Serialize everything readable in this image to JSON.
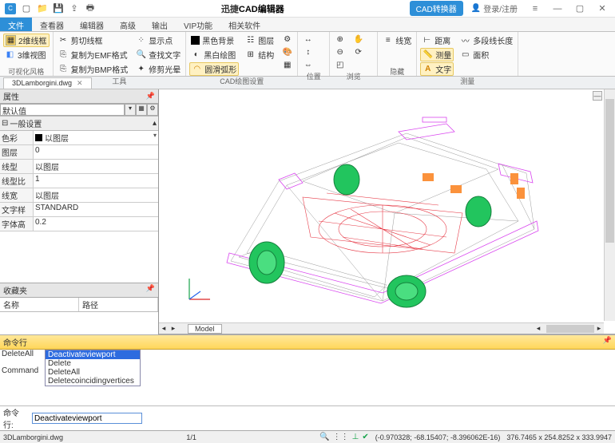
{
  "titlebar": {
    "app_title_prefix": "迅捷",
    "app_title_suffix": "CAD编辑器",
    "cad_converter": "CAD转换器",
    "login": "登录/注册"
  },
  "menubar": {
    "tabs": [
      "文件",
      "查看器",
      "编辑器",
      "高级",
      "输出",
      "VIP功能",
      "相关软件"
    ]
  },
  "ribbon": {
    "g1": {
      "btn1": "2维线框",
      "btn2": "3维视图",
      "label": "可视化风格"
    },
    "g2": {
      "a": "剪切线框",
      "b": "复制为EMF格式",
      "c": "复制为BMP格式",
      "d": "显示点",
      "e": "查找文字",
      "f": "修剪光晕",
      "label": "工具"
    },
    "g3": {
      "a": "黑色背景",
      "b": "黑白绘图",
      "c": "圆滑弧形",
      "d": "图层",
      "e": "结构",
      "label": "CAD绘图设置"
    },
    "g4": {
      "label": "位置"
    },
    "g5": {
      "label": "浏览"
    },
    "g6": {
      "a": "线宽",
      "label": "隐藏"
    },
    "g7": {
      "a": "距离",
      "b": "测量",
      "c": "文字",
      "d": "多段线长度",
      "e": "面积",
      "label": "测量"
    }
  },
  "file_tab": {
    "name": "3DLamborgini.dwg"
  },
  "props": {
    "panel_title": "属性",
    "default_value": "默认值",
    "section": "一般设置",
    "rows": {
      "color": {
        "k": "色彩",
        "v": "以图层"
      },
      "layer": {
        "k": "图层",
        "v": "0"
      },
      "ltype": {
        "k": "线型",
        "v": "以图层"
      },
      "lscale": {
        "k": "线型比",
        "v": "1"
      },
      "lweight": {
        "k": "线宽",
        "v": "以图层"
      },
      "tstyle": {
        "k": "文字样",
        "v": "STANDARD"
      },
      "theight": {
        "k": "字体高",
        "v": "0.2"
      }
    }
  },
  "fav": {
    "title": "收藏夹",
    "col1": "名称",
    "col2": "路径"
  },
  "viewport": {
    "model_tab": "Model"
  },
  "cmd": {
    "header": "命令行",
    "rows": {
      "r1": {
        "k": "DeleteAll",
        "v": "Deactivateviewport"
      },
      "r2": {
        "k": "Command",
        "v": ""
      }
    },
    "dropdown": [
      "Deactivateviewport",
      "Delete",
      "DeleteAll",
      "Deletecoincidingvertices"
    ],
    "input_label": "命令行:",
    "input_value": "Deactivateviewport"
  },
  "status": {
    "file": "3DLamborgini.dwg",
    "page": "1/1",
    "coords": "(-0.970328; -68.15407; -8.396062E-16)",
    "dims": "376.7465 x 254.8252 x 333.9947"
  }
}
